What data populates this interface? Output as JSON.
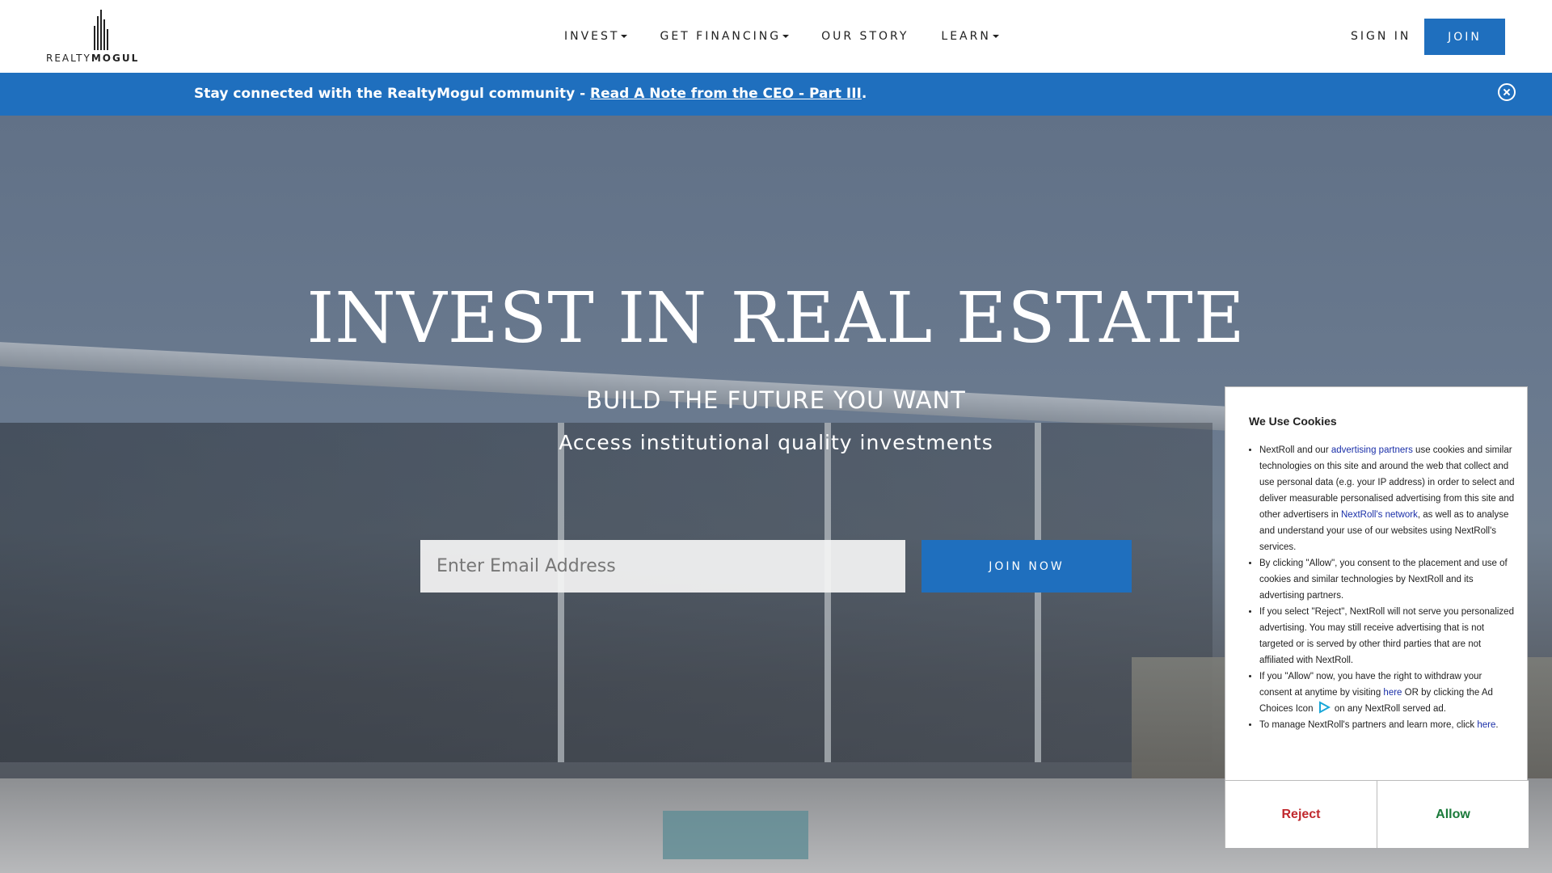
{
  "header": {
    "logo_text_light": "REALTY",
    "logo_text_bold": "MOGUL",
    "nav": [
      {
        "label": "INVEST",
        "has_caret": true
      },
      {
        "label": "GET FINANCING",
        "has_caret": true
      },
      {
        "label": "OUR STORY",
        "has_caret": false
      },
      {
        "label": "LEARN",
        "has_caret": true
      }
    ],
    "sign_in": "SIGN IN",
    "join": "JOIN"
  },
  "announcement": {
    "prefix": "Stay connected with the RealtyMogul community - ",
    "link": "Read A Note from the CEO - Part III",
    "suffix": ".",
    "close_icon": "close-circle-icon"
  },
  "hero": {
    "title": "INVEST IN REAL ESTATE",
    "subtitle": "BUILD THE FUTURE YOU WANT",
    "tagline": "Access institutional quality investments",
    "email_placeholder": "Enter Email Address",
    "cta": "JOIN NOW"
  },
  "cookie": {
    "title": "We Use Cookies",
    "items": {
      "i1_a": "NextRoll and our ",
      "i1_link1": "advertising partners",
      "i1_b": " use cookies and similar technologies on this site and around the web that collect and use personal data (e.g. your IP address) in order to select and deliver measurable personalised advertising from this site and other advertisers in ",
      "i1_link2": "NextRoll's network",
      "i1_c": ", as well as to analyse and understand your use of our websites using NextRoll's services.",
      "i2": "By clicking \"Allow\", you consent to the placement and use of cookies and similar technologies by NextRoll and its advertising partners.",
      "i3": "If you select \"Reject\", NextRoll will not serve you personalized advertising. You may still receive advertising that is not targeted or is served by other third parties that are not affiliated with NextRoll.",
      "i4_a": "If you \"Allow\" now, you have the right to withdraw your consent at anytime by visiting ",
      "i4_link": "here",
      "i4_b": " OR by clicking the Ad Choices Icon ",
      "i4_c": " on any NextRoll served ad.",
      "i5_a": "To manage NextRoll's partners and learn more, click ",
      "i5_link": "here",
      "i5_b": "."
    },
    "reject": "Reject",
    "allow": "Allow",
    "colors": {
      "reject": "#c0282d",
      "allow": "#1a7a3a",
      "link": "#1a2fa8"
    }
  },
  "colors": {
    "brand_blue": "#1f6fbe"
  }
}
